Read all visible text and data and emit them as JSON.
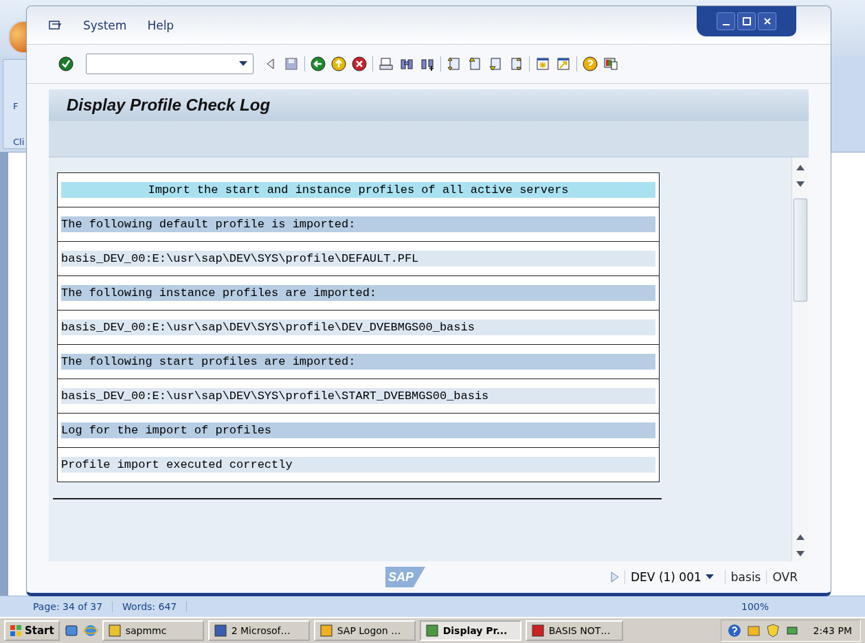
{
  "background_window": {
    "ribbon_texts": [
      "F",
      "Cli"
    ],
    "status_bar": [
      "Page: 34 of 37",
      "Words: 647"
    ],
    "zoom": "100%"
  },
  "sap_window": {
    "menu": [
      {
        "label": "System"
      },
      {
        "label": "Help"
      }
    ],
    "title": "Display Profile Check Log",
    "log_lines": [
      {
        "kind": "heading",
        "text": "Import the start and instance profiles of all active servers"
      },
      {
        "kind": "section",
        "text": "The following default profile is imported:"
      },
      {
        "kind": "entry",
        "text": "basis_DEV_00:E:\\usr\\sap\\DEV\\SYS\\profile\\DEFAULT.PFL"
      },
      {
        "kind": "section",
        "text": "The following instance profiles are imported:"
      },
      {
        "kind": "entry",
        "text": "basis_DEV_00:E:\\usr\\sap\\DEV\\SYS\\profile\\DEV_DVEBMGS00_basis"
      },
      {
        "kind": "section",
        "text": "The following start profiles are imported:"
      },
      {
        "kind": "entry",
        "text": "basis_DEV_00:E:\\usr\\sap\\DEV\\SYS\\profile\\START_DVEBMGS00_basis"
      },
      {
        "kind": "section",
        "text": "Log for the import of profiles"
      },
      {
        "kind": "entry",
        "text": "Profile import executed correctly"
      }
    ],
    "logo": "SAP",
    "status": {
      "system": "DEV (1) 001",
      "user": "basis",
      "mode": "OVR"
    }
  },
  "taskbar": {
    "start": "Start",
    "tasks": [
      {
        "label": "sapmmc",
        "selected": false
      },
      {
        "label": "2 Microsof…",
        "selected": false
      },
      {
        "label": "SAP Logon …",
        "selected": false
      },
      {
        "label": "Display Pr...",
        "selected": true
      },
      {
        "label": "BASIS NOT…",
        "selected": false
      }
    ],
    "clock": "2:43 PM"
  }
}
